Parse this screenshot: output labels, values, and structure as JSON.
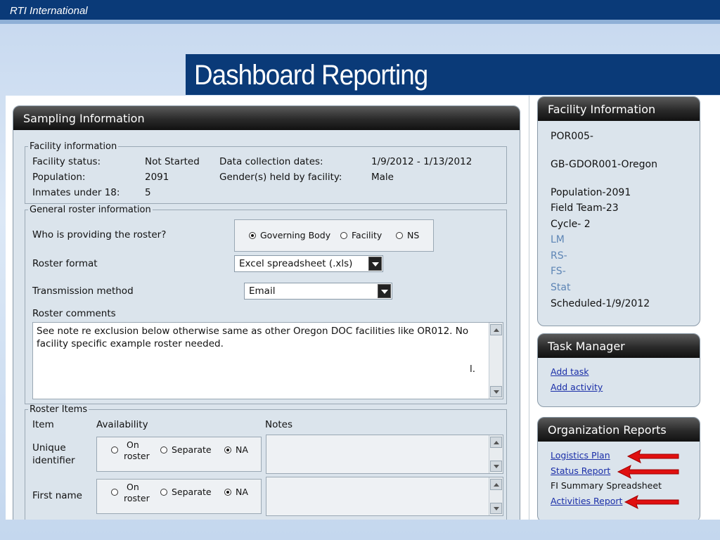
{
  "slide": {
    "brand": "RTI International",
    "title": "Dashboard Reporting"
  },
  "sampling": {
    "header": "Sampling Information",
    "facility_info": {
      "legend": "Facility information",
      "status_label": "Facility status:",
      "status_value": "Not Started",
      "population_label": "Population:",
      "population_value": "2091",
      "under18_label": "Inmates under 18:",
      "under18_value": "5",
      "dates_label": "Data collection dates:",
      "dates_value": "1/9/2012 - 1/13/2012",
      "gender_label": "Gender(s) held by facility:",
      "gender_value": "Male"
    },
    "roster_info": {
      "legend": "General roster information",
      "provider_label": "Who is providing the roster?",
      "provider_options": [
        "Governing Body",
        "Facility",
        "NS"
      ],
      "format_label": "Roster format",
      "format_value": "Excel spreadsheet (.xls)",
      "transmission_label": "Transmission method",
      "transmission_value": "Email",
      "comments_label": "Roster comments",
      "comments_line1": "See note re exclusion below otherwise same as other Oregon DOC facilities like OR012.  No",
      "comments_line2": "facility specific example roster needed.",
      "comments_mark": "l."
    },
    "roster_items": {
      "legend": "Roster Items",
      "col_item": "Item",
      "col_availability": "Availability",
      "col_notes": "Notes",
      "opt_on_line1": "On",
      "opt_on_line2": "roster",
      "opt_separate": "Separate",
      "opt_na": "NA",
      "rows": [
        {
          "line1": "Unique",
          "line2": "identifier"
        },
        {
          "line1": "First name",
          "line2": ""
        }
      ]
    }
  },
  "facility_panel": {
    "header": "Facility Information",
    "lines": [
      "POR005-",
      "GB-GDOR001-Oregon",
      "Population-2091",
      "Field Team-23",
      "Cycle- 2",
      "LM",
      "RS-",
      "FS-",
      "Stat",
      "Scheduled-1/9/2012"
    ]
  },
  "task_panel": {
    "header": "Task Manager",
    "links": [
      "Add task",
      "Add activity"
    ]
  },
  "org_panel": {
    "header": "Organization Reports",
    "items": [
      "Logistics Plan",
      "Status Report",
      "FI Summary Spreadsheet",
      "Activities Report"
    ]
  },
  "colors": {
    "brand_blue": "#0a3a78",
    "panel_bg": "#dbe4ec",
    "link_blue": "#1a2ea8",
    "arrow_red": "#e01010"
  }
}
